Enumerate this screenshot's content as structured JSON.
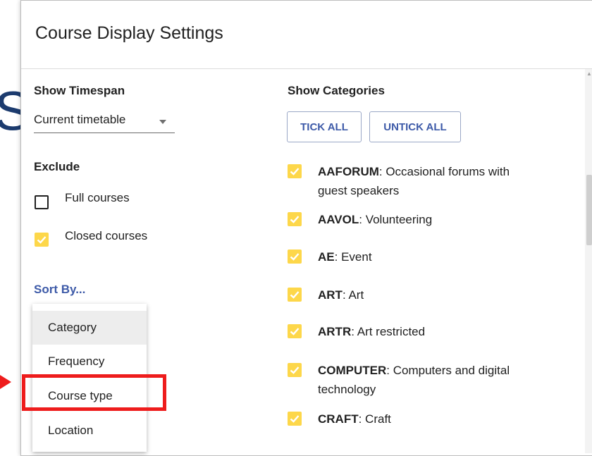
{
  "background": {
    "partial_letter": "S"
  },
  "dialog": {
    "title": "Course Display Settings"
  },
  "timespan": {
    "label": "Show Timespan",
    "value": "Current timetable"
  },
  "exclude": {
    "label": "Exclude",
    "options": [
      {
        "label": "Full courses",
        "checked": false
      },
      {
        "label": "Closed courses",
        "checked": true
      }
    ]
  },
  "sort": {
    "label": "Sort By...",
    "options": [
      "Category",
      "Frequency",
      "Course type",
      "Location"
    ],
    "highlighted": "Category",
    "annotated": "Course type"
  },
  "categories": {
    "label": "Show Categories",
    "tick_all": "TICK ALL",
    "untick_all": "UNTICK ALL",
    "items": [
      {
        "code": "AAFORUM",
        "desc": ": Occasional forums with guest speakers",
        "checked": true
      },
      {
        "code": "AAVOL",
        "desc": ": Volunteering",
        "checked": true
      },
      {
        "code": "AE",
        "desc": ": Event",
        "checked": true
      },
      {
        "code": "ART",
        "desc": ": Art",
        "checked": true
      },
      {
        "code": "ARTR",
        "desc": ": Art restricted",
        "checked": true
      },
      {
        "code": "COMPUTER",
        "desc": ": Computers and digital technology",
        "checked": true
      },
      {
        "code": "CRAFT",
        "desc": ": Craft",
        "checked": true
      }
    ]
  },
  "colors": {
    "checkbox_checked": "#fdd74a",
    "link_blue": "#3d5aa8",
    "annotation_red": "#ee1c1c"
  }
}
